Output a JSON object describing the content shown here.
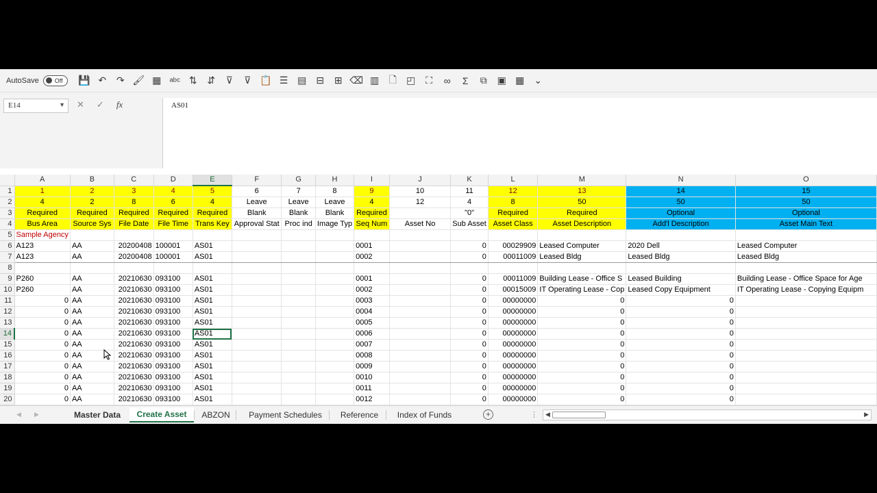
{
  "toolbar": {
    "autosave_label": "AutoSave",
    "autosave_state": "Off",
    "icons": [
      "save-icon",
      "undo-icon",
      "redo-icon",
      "format-painter-icon",
      "select-icon",
      "spelling-icon",
      "sort-asc-icon",
      "sort-desc-icon",
      "clear-filter-icon",
      "filter-icon",
      "paste-icon",
      "delete-rows-icon",
      "insert-rows-icon",
      "delete-cells-icon",
      "merge-icon",
      "clear-icon",
      "delete-columns-icon",
      "new-doc-icon",
      "shapes-icon",
      "screenshot-icon",
      "link-icon",
      "sum-icon",
      "insert-object-icon",
      "sheet-icon",
      "calculator-icon",
      "customize-icon"
    ]
  },
  "formula_bar": {
    "name_box": "E14",
    "cancel": "✕",
    "enter": "✓",
    "fx": "fx",
    "formula": "AS01"
  },
  "columns": [
    "A",
    "B",
    "C",
    "D",
    "E",
    "F",
    "G",
    "H",
    "I",
    "J",
    "K",
    "L",
    "M",
    "N",
    "O"
  ],
  "rows": [
    {
      "n": "1",
      "cells": [
        "1",
        "2",
        "3",
        "4",
        "5",
        "6",
        "7",
        "8",
        "9",
        "10",
        "11",
        "12",
        "13",
        "14",
        "15"
      ]
    },
    {
      "n": "2",
      "cells": [
        "4",
        "2",
        "8",
        "6",
        "4",
        "Leave",
        "Leave",
        "Leave",
        "4",
        "12",
        "4",
        "8",
        "50",
        "50",
        "50"
      ]
    },
    {
      "n": "3",
      "cells": [
        "Required",
        "Required",
        "Required",
        "Required",
        "Required",
        "Blank",
        "Blank",
        "Blank",
        "Required",
        "",
        "\"0\"",
        "Required",
        "Required",
        "Optional",
        "Optional"
      ]
    },
    {
      "n": "4",
      "cells": [
        "Bus Area",
        "Source Sys",
        "File Date",
        "File Time",
        "Trans Key",
        "Approval Stat",
        "Proc ind",
        "Image Typ",
        "Seq Num",
        "Asset No",
        "Sub Asset",
        "Asset Class",
        "Asset Description",
        "Add'l Description",
        "Asset Main Text"
      ]
    },
    {
      "n": "5",
      "cells": [
        "Sample Agency",
        "",
        "",
        "",
        "",
        "",
        "",
        "",
        "",
        "",
        "",
        "",
        "",
        "",
        ""
      ]
    },
    {
      "n": "6",
      "cells": [
        "A123",
        "AA",
        "20200408",
        "100001",
        "AS01",
        "",
        "",
        "",
        "0001",
        "",
        "0",
        "00029909",
        "Leased Computer",
        "2020 Dell",
        "Leased Computer"
      ]
    },
    {
      "n": "7",
      "cells": [
        "A123",
        "AA",
        "20200408",
        "100001",
        "AS01",
        "",
        "",
        "",
        "0002",
        "",
        "0",
        "00011009",
        "Leased Bldg",
        "Leased Bldg",
        "Leased Bldg"
      ]
    },
    {
      "n": "8",
      "cells": [
        "",
        "",
        "",
        "",
        "",
        "",
        "",
        "",
        "",
        "",
        "",
        "",
        "",
        "",
        ""
      ]
    },
    {
      "n": "9",
      "cells": [
        "P260",
        "AA",
        "20210630",
        "093100",
        "AS01",
        "",
        "",
        "",
        "0001",
        "",
        "0",
        "00011009",
        "Building Lease - Office S",
        "Leased Building",
        "Building Lease - Office Space for Age"
      ]
    },
    {
      "n": "10",
      "cells": [
        "P260",
        "AA",
        "20210630",
        "093100",
        "AS01",
        "",
        "",
        "",
        "0002",
        "",
        "0",
        "00015009",
        "IT Operating Lease - Cop",
        "Leased Copy Equipment",
        "IT Operating Lease - Copying Equipm"
      ]
    },
    {
      "n": "11",
      "cells": [
        "0",
        "AA",
        "20210630",
        "093100",
        "AS01",
        "",
        "",
        "",
        "0003",
        "",
        "0",
        "00000000",
        "0",
        "0",
        ""
      ]
    },
    {
      "n": "12",
      "cells": [
        "0",
        "AA",
        "20210630",
        "093100",
        "AS01",
        "",
        "",
        "",
        "0004",
        "",
        "0",
        "00000000",
        "0",
        "0",
        ""
      ]
    },
    {
      "n": "13",
      "cells": [
        "0",
        "AA",
        "20210630",
        "093100",
        "AS01",
        "",
        "",
        "",
        "0005",
        "",
        "0",
        "00000000",
        "0",
        "0",
        ""
      ]
    },
    {
      "n": "14",
      "cells": [
        "0",
        "AA",
        "20210630",
        "093100",
        "AS01",
        "",
        "",
        "",
        "0006",
        "",
        "0",
        "00000000",
        "0",
        "0",
        ""
      ]
    },
    {
      "n": "15",
      "cells": [
        "0",
        "AA",
        "20210630",
        "093100",
        "AS01",
        "",
        "",
        "",
        "0007",
        "",
        "0",
        "00000000",
        "0",
        "0",
        ""
      ]
    },
    {
      "n": "16",
      "cells": [
        "0",
        "AA",
        "20210630",
        "093100",
        "AS01",
        "",
        "",
        "",
        "0008",
        "",
        "0",
        "00000000",
        "0",
        "0",
        ""
      ]
    },
    {
      "n": "17",
      "cells": [
        "0",
        "AA",
        "20210630",
        "093100",
        "AS01",
        "",
        "",
        "",
        "0009",
        "",
        "0",
        "00000000",
        "0",
        "0",
        ""
      ]
    },
    {
      "n": "18",
      "cells": [
        "0",
        "AA",
        "20210630",
        "093100",
        "AS01",
        "",
        "",
        "",
        "0010",
        "",
        "0",
        "00000000",
        "0",
        "0",
        ""
      ]
    },
    {
      "n": "19",
      "cells": [
        "0",
        "AA",
        "20210630",
        "093100",
        "AS01",
        "",
        "",
        "",
        "0011",
        "",
        "0",
        "00000000",
        "0",
        "0",
        ""
      ]
    },
    {
      "n": "20",
      "cells": [
        "0",
        "AA",
        "20210630",
        "093100",
        "AS01",
        "",
        "",
        "",
        "0012",
        "",
        "0",
        "00000000",
        "0",
        "0",
        ""
      ]
    }
  ],
  "active_cell": {
    "row": "14",
    "col": "E"
  },
  "colors": {
    "required": "#ffff00",
    "optional": "#00b0f0",
    "accent": "#1e7145",
    "sample": "#c00000"
  },
  "sheet_tabs": [
    "Master Data",
    "Create Asset",
    "ABZON",
    "Payment Schedules",
    "Reference",
    "Index of Funds"
  ],
  "active_tab": "Create Asset"
}
